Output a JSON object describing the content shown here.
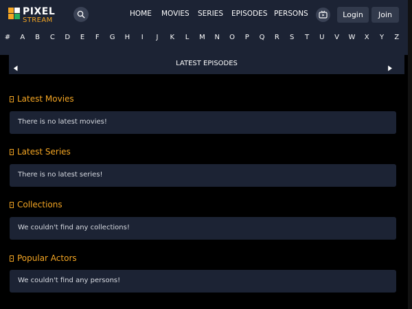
{
  "brand": {
    "name_top": "PIXEL",
    "name_bottom": "STREAM",
    "colors": {
      "accent": "#f5a623",
      "green": "#27ae60",
      "panel": "#1c2334",
      "background": "#000000"
    }
  },
  "header": {
    "search_icon": "search-icon",
    "nav": [
      {
        "label": "HOME"
      },
      {
        "label": "MOVIES"
      },
      {
        "label": "SERIES"
      },
      {
        "label": "EPISODES"
      },
      {
        "label": "PERSONS"
      }
    ],
    "tv_icon": "tv-icon",
    "login_label": "Login",
    "join_label": "Join"
  },
  "alphabet": [
    "#",
    "A",
    "B",
    "C",
    "D",
    "E",
    "F",
    "G",
    "H",
    "I",
    "J",
    "K",
    "L",
    "M",
    "N",
    "O",
    "P",
    "Q",
    "R",
    "S",
    "T",
    "U",
    "V",
    "W",
    "X",
    "Y",
    "Z"
  ],
  "episodes_bar": {
    "title": "LATEST EPISODES",
    "prev_icon": "triangle-left-icon",
    "next_icon": "triangle-right-icon"
  },
  "sections": [
    {
      "title": "Latest Movies",
      "message": "There is no latest movies!"
    },
    {
      "title": "Latest Series",
      "message": "There is no latest series!"
    },
    {
      "title": "Collections",
      "message": "We couldn't find any collections!"
    },
    {
      "title": "Popular Actors",
      "message": "We couldn't find any persons!"
    }
  ]
}
